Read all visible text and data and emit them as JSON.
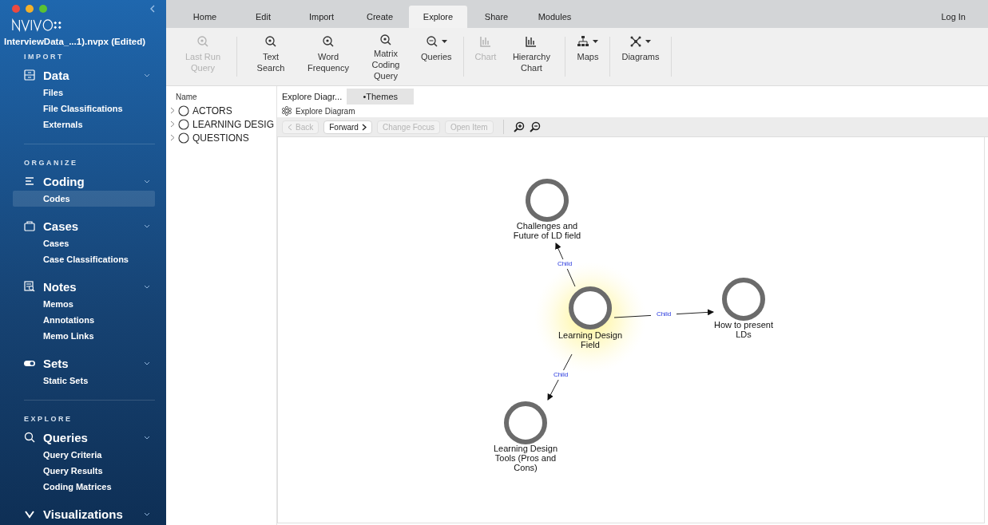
{
  "sidebar": {
    "project_title": "InterviewData_...1).nvpx (Edited)",
    "sections": [
      {
        "header": "IMPORT",
        "groups": [
          {
            "kind": "data",
            "label": "Data",
            "items": [
              {
                "label": "Files",
                "selected": false
              },
              {
                "label": "File Classifications",
                "selected": false
              },
              {
                "label": "Externals",
                "selected": false
              }
            ]
          }
        ]
      },
      {
        "header": "ORGANIZE",
        "groups": [
          {
            "kind": "coding",
            "label": "Coding",
            "items": [
              {
                "label": "Codes",
                "selected": true
              }
            ]
          },
          {
            "kind": "cases",
            "label": "Cases",
            "items": [
              {
                "label": "Cases",
                "selected": false
              },
              {
                "label": "Case Classifications",
                "selected": false
              }
            ]
          },
          {
            "kind": "notes",
            "label": "Notes",
            "items": [
              {
                "label": "Memos",
                "selected": false
              },
              {
                "label": "Annotations",
                "selected": false
              },
              {
                "label": "Memo Links",
                "selected": false
              }
            ]
          },
          {
            "kind": "sets",
            "label": "Sets",
            "items": [
              {
                "label": "Static Sets",
                "selected": false
              }
            ]
          }
        ]
      },
      {
        "header": "EXPLORE",
        "groups": [
          {
            "kind": "queries",
            "label": "Queries",
            "items": [
              {
                "label": "Query Criteria",
                "selected": false
              },
              {
                "label": "Query Results",
                "selected": false
              },
              {
                "label": "Coding Matrices",
                "selected": false
              }
            ]
          },
          {
            "kind": "visualizations",
            "label": "Visualizations"
          }
        ]
      }
    ]
  },
  "ribbon_tabs": [
    {
      "label": "Home",
      "selected": false
    },
    {
      "label": "Edit",
      "selected": false
    },
    {
      "label": "Import",
      "selected": false
    },
    {
      "label": "Create",
      "selected": false
    },
    {
      "label": "Explore",
      "selected": true
    },
    {
      "label": "Share",
      "selected": false
    },
    {
      "label": "Modules",
      "selected": false
    }
  ],
  "login": "Log In",
  "toolbar": [
    {
      "kind": "search",
      "label": "Last Run Query",
      "disabled": true,
      "dropdown": false
    },
    {
      "kind": "search",
      "label": "Text Search",
      "disabled": false,
      "dropdown": false
    },
    {
      "kind": "search",
      "label": "Word Frequency",
      "disabled": false,
      "dropdown": false
    },
    {
      "kind": "search",
      "label": "Matrix Coding Query",
      "disabled": false,
      "dropdown": false
    },
    {
      "kind": "search",
      "label": "Queries",
      "disabled": false,
      "dropdown": true
    },
    {
      "kind": "chart",
      "label": "Chart",
      "disabled": true,
      "dropdown": false
    },
    {
      "kind": "chart",
      "label": "Hierarchy Chart",
      "disabled": false,
      "dropdown": false
    },
    {
      "kind": "maps",
      "label": "Maps",
      "disabled": false,
      "dropdown": true
    },
    {
      "kind": "diagrams",
      "label": "Diagrams",
      "disabled": false,
      "dropdown": true
    }
  ],
  "codes_panel": {
    "column": "Name",
    "items": [
      {
        "label": "ACTORS",
        "expanded": false
      },
      {
        "label": "LEARNING DESIG",
        "expanded": false
      },
      {
        "label": "QUESTIONS",
        "expanded": false
      }
    ]
  },
  "document_tabs": [
    {
      "label": "Explore Diagr...",
      "selected": true
    },
    {
      "label": "•Themes",
      "selected": false
    }
  ],
  "breadcrumb": "Explore Diagram",
  "diagram_buttons": [
    {
      "label": "Back",
      "kind": "back",
      "disabled": true
    },
    {
      "label": "Forward",
      "kind": "forward",
      "disabled": false
    },
    {
      "label": "Change Focus",
      "kind": "plain",
      "disabled": true
    },
    {
      "label": "Open Item",
      "kind": "plain",
      "disabled": true
    }
  ],
  "diagram": {
    "focus": {
      "label": "Learning Design Field",
      "highlighted": true,
      "children": [
        {
          "label": "Challenges and Future of LD field",
          "edge_label": "Child"
        },
        {
          "label": "How to present LDs",
          "edge_label": "Child"
        },
        {
          "label": "Learning Design Tools (Pros and Cons)",
          "edge_label": "Child"
        }
      ]
    }
  }
}
